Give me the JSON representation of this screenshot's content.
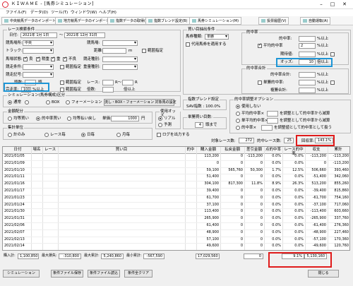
{
  "window": {
    "title": "ＫＩＷＡＭＥ - [馬券シミュレーション]"
  },
  "menu": [
    "ファイル(F)",
    "データ(D)",
    "ツール(T)",
    "ウィンドウ(W)",
    "ヘルプ(H)"
  ],
  "tabs": [
    "中央競馬データのインポート(S)",
    "地方競馬データのインポート(L)",
    "指数データの取得(I)",
    "指数ブレンド設定(B)",
    "馬券シミュレーション(M)",
    "投票履歴(V)",
    "自動運転(A)"
  ],
  "race": {
    "group_label": "レース検索条件",
    "date_label": "日付:",
    "date_from": "2021年 1月 1日",
    "date_tilde": "～",
    "date_to": "2021年 12月 31日",
    "venue_label": "競馬場所:",
    "venue": "中央",
    "course_label": "競馬場:",
    "track_label": "トラック:",
    "distance_label": "距離:",
    "distance_unit": "m",
    "range_label": "範囲指定",
    "condition_label": "馬場状態:",
    "cond_good": "良",
    "cond_slightly": "稍重",
    "cond_heavy": "重",
    "cond_bad": "不良",
    "race_type_label": "競走種別:",
    "race_cond_label": "競走条件:",
    "weight_label": "競走記号:",
    "weight2_label": "重量種別:",
    "horses_label": "頭数:",
    "horses_unit": "頭",
    "range2_label": "範囲指定",
    "race_label": "レース:",
    "race_from": "R～",
    "race_to": "R",
    "rate_label": "完走率:",
    "rate_value": "100",
    "rate_unit": "%以上",
    "popular_label": "人気順:",
    "popular_unit": "番人気",
    "odds_label": "倍数:",
    "odds_unit": "倍以上"
  },
  "buy": {
    "group_label": "買い目抽出条件",
    "ticket_label": "馬券種類:",
    "ticket": "単勝",
    "bet_label": "代用馬券を適用する",
    "time_group": "的中率",
    "time_rate": "的中率:",
    "time_unit": "%以上",
    "avg_label": "平均的中率",
    "avg_value": "2",
    "avg_unit": "%以上",
    "freq_label": "期待値:",
    "freq_unit": "%以上",
    "range_label": "範囲指定",
    "odds_label": "オッズ:",
    "odds_value": "10",
    "odds_unit": "倍以上",
    "pay_group": "的中率合計",
    "sum_label": "的中率合計:",
    "sum_unit": "%以上",
    "single_label": "単勝的中率:",
    "single_unit": "%以上",
    "reverse_label": "範囲指定",
    "place_label": "複勝合計:",
    "place_unit": "%以上"
  },
  "sim": {
    "group_label": "シミュレーション(馬券構成)区分",
    "normal": "通常",
    "box": "BOX",
    "formation": "フォーメーション",
    "flow_btn": "流し・BOX・フォーメーション 対象馬の設定"
  },
  "amount": {
    "group_label": "金額配分",
    "uniform": "均等買い",
    "target": "的中率買い",
    "uniform_return": "均等払い戻し",
    "unit_label": "単価:",
    "unit_value": "1000",
    "unit_yen": "円"
  },
  "agg": {
    "group_label": "集計単位",
    "by_total": "計のみ",
    "by_race": "レース毎",
    "by_day": "日毎",
    "by_month": "月毎"
  },
  "usage": {
    "group_label": "使用オッズ",
    "real": "リアル",
    "forecast": "予測"
  },
  "log_label": "ログを出力する",
  "index": {
    "group_label": "指数ブレンド設定",
    "name": "SAV指数 : 100.0%"
  },
  "select": {
    "group_label": "単勝買い目数:",
    "value": "4",
    "unit": "頭まで"
  },
  "hit": {
    "group_label": "的中率調整オプション",
    "not_use": "使用しない",
    "opt1_prefix": "平均的中率×",
    "opt1_suffix": "を調整として的中率から減算",
    "opt2_prefix": "単平均的中率×",
    "opt2_suffix": "を調整として的中率から減算",
    "opt3_prefix": "的中率×",
    "opt3_suffix": "を調整値として的中率として扱う"
  },
  "summary": {
    "target_races_label": "対象レース数:",
    "target_races": "272",
    "hit_races_label": "的中レース数:",
    "hit_races": "25",
    "recovery_label": "回収率:",
    "recovery": "143.1%"
  },
  "table": {
    "headers": [
      "日付",
      "場名",
      "レース",
      "買い目",
      "的中",
      "購入金額",
      "払戻金額",
      "差引金額",
      "点的中率",
      "レース的中率",
      "収支",
      "累計"
    ],
    "rows": [
      [
        "2021/01/05",
        "",
        "",
        "",
        "",
        "113,200",
        "0",
        "-113,200",
        "0.0%",
        "0.0%",
        "-113,200",
        "-113,200"
      ],
      [
        "2021/01/09",
        "",
        "",
        "",
        "",
        "0",
        "0",
        "0",
        "0.0%",
        "0.0%",
        "0",
        "-113,200"
      ],
      [
        "2021/01/10",
        "",
        "",
        "",
        "",
        "59,100",
        "565,760",
        "50,300",
        "1.7%",
        "12.5%",
        "506,660",
        "393,460"
      ],
      [
        "2021/01/11",
        "",
        "",
        "",
        "",
        "51,400",
        "0",
        "0",
        "0.0%",
        "0.0%",
        "-51,400",
        "342,060"
      ],
      [
        "2021/01/16",
        "",
        "",
        "",
        "",
        "304,100",
        "817,300",
        "11.8%",
        "8.9%",
        "26.3%",
        "513,200",
        "855,260"
      ],
      [
        "2021/01/17",
        "",
        "",
        "",
        "",
        "39,400",
        "0",
        "0",
        "0.0%",
        "0.0%",
        "-39,400",
        "815,860"
      ],
      [
        "2021/01/23",
        "",
        "",
        "",
        "",
        "61,700",
        "0",
        "0",
        "0.0%",
        "0.0%",
        "-61,700",
        "754,160"
      ],
      [
        "2021/01/24",
        "",
        "",
        "",
        "",
        "37,100",
        "0",
        "0",
        "0.0%",
        "0.0%",
        "-37,100",
        "717,060"
      ],
      [
        "2021/01/30",
        "",
        "",
        "",
        "",
        "113,400",
        "0",
        "0",
        "0.0%",
        "0.0%",
        "-113,400",
        "603,660"
      ],
      [
        "2021/01/31",
        "",
        "",
        "",
        "",
        "265,900",
        "0",
        "0",
        "0.0%",
        "0.0%",
        "-265,900",
        "337,760"
      ],
      [
        "2021/02/06",
        "",
        "",
        "",
        "",
        "61,400",
        "0",
        "0",
        "0.0%",
        "0.0%",
        "-61,400",
        "276,360"
      ],
      [
        "2021/02/07",
        "",
        "",
        "",
        "",
        "48,900",
        "0",
        "0",
        "0.0%",
        "0.0%",
        "-48,900",
        "227,460"
      ],
      [
        "2021/02/13",
        "",
        "",
        "",
        "",
        "57,100",
        "0",
        "0",
        "0.0%",
        "0.0%",
        "-57,100",
        "170,360"
      ],
      [
        "2021/02/14",
        "",
        "",
        "",
        "",
        "49,600",
        "0",
        "0",
        "0.0%",
        "0.0%",
        "-49,600",
        "120,760"
      ]
    ]
  },
  "totals": {
    "total_buy_label": "購入計:",
    "total_buy": "1,100,850",
    "max_loss_label": "最大損失:",
    "max_loss": "-310,800",
    "max_total_label": "最大累計:",
    "max_total": "5,240,860",
    "min_total_label": "最小累計:",
    "min_total": "-567,590",
    "pay_total": "17,029,560",
    "diff_total": "0",
    "recovery_pct": "9.1%",
    "final_total": "5,130,160"
  },
  "buttons": {
    "simulate": "シミュレーション",
    "save": "条件ファイル保存",
    "load": "条件ファイル読込",
    "clear": "条件全クリア",
    "close": "閉じる"
  }
}
